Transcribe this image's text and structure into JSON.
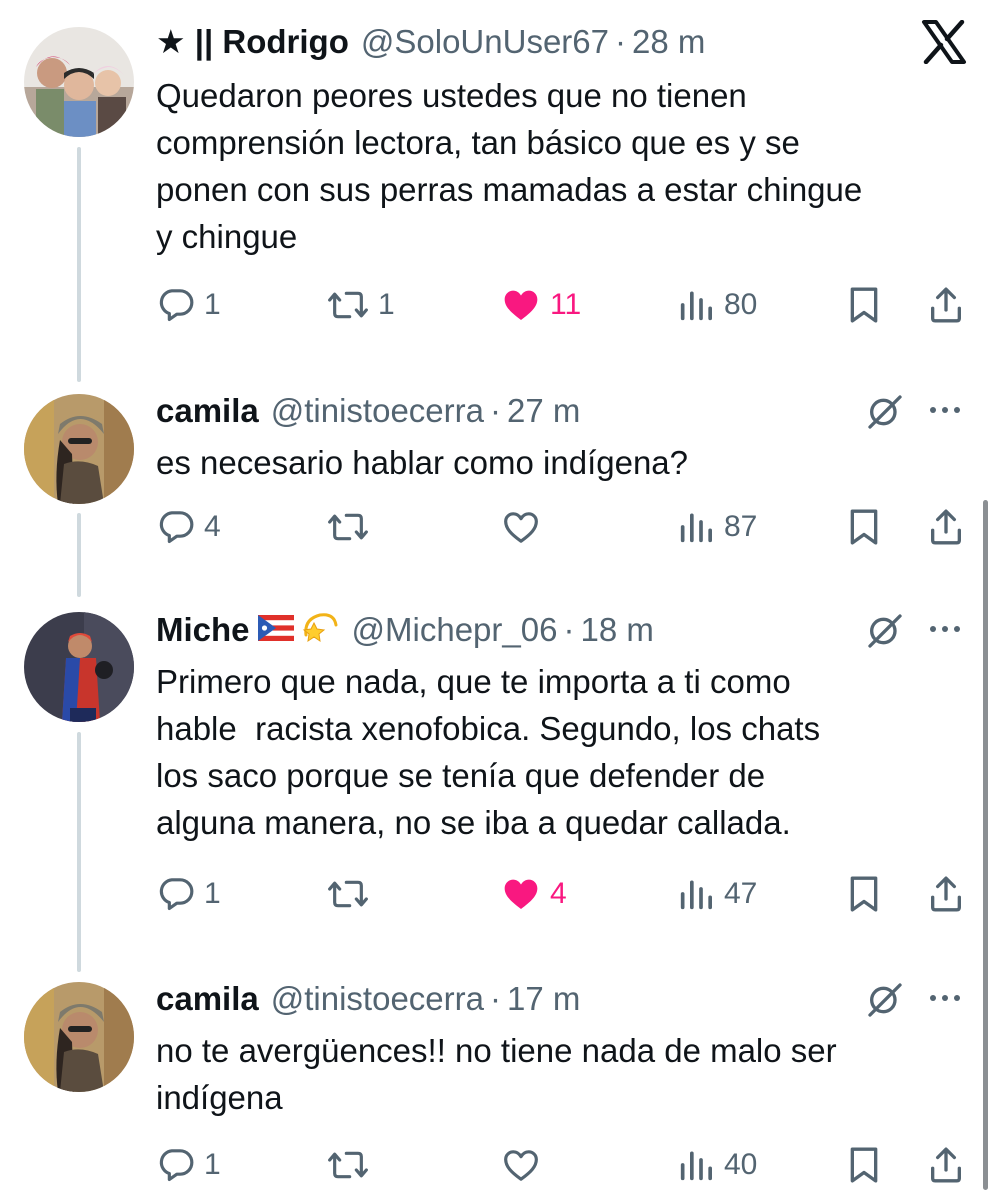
{
  "tweets": [
    {
      "name": "★ || Rodrigo",
      "handle": "@SoloUnUser67",
      "separator": "·",
      "time": "28 m",
      "text": "Quedaron peores ustedes que no tienen\ncomprensión lectora, tan básico que es y se\nponen con sus perras mamadas a estar chingue\ny chingue",
      "replies": "1",
      "reposts": "1",
      "likes": "11",
      "views": "80",
      "liked": true
    },
    {
      "name": "camila",
      "handle": "@tinistoecerra",
      "separator": "·",
      "time": "27 m",
      "text": "es necesario hablar como indígena?",
      "replies": "4",
      "reposts": "",
      "likes": "",
      "views": "87",
      "liked": false
    },
    {
      "name": "Miche",
      "flag_emoji": "puerto-rico-flag",
      "extra_emoji": "dizzy-star",
      "handle": "@Michepr_06",
      "separator": "·",
      "time": "18 m",
      "text": "Primero que nada, que te importa a ti como\nhable  racista xenofobica. Segundo, los chats\nlos saco porque se tenía que defender de\nalguna manera, no se iba a quedar callada.",
      "replies": "1",
      "reposts": "",
      "likes": "4",
      "views": "47",
      "liked": true
    },
    {
      "name": "camila",
      "handle": "@tinistoecerra",
      "separator": "·",
      "time": "17 m",
      "text": "no te avergüences!! no tiene nada de malo ser\nindígena",
      "replies": "1",
      "reposts": "",
      "likes": "",
      "views": "40",
      "liked": false
    }
  ],
  "icons": {
    "reply": "reply-icon",
    "repost": "repost-icon",
    "like": "heart-icon",
    "views": "views-icon",
    "bookmark": "bookmark-icon",
    "share": "share-icon",
    "grok": "grok-icon",
    "more": "more-icon",
    "brand": "x-logo-icon"
  },
  "colors": {
    "text": "#0f1419",
    "secondary": "#536471",
    "like": "#f91880",
    "thread_line": "#cfd9de"
  }
}
